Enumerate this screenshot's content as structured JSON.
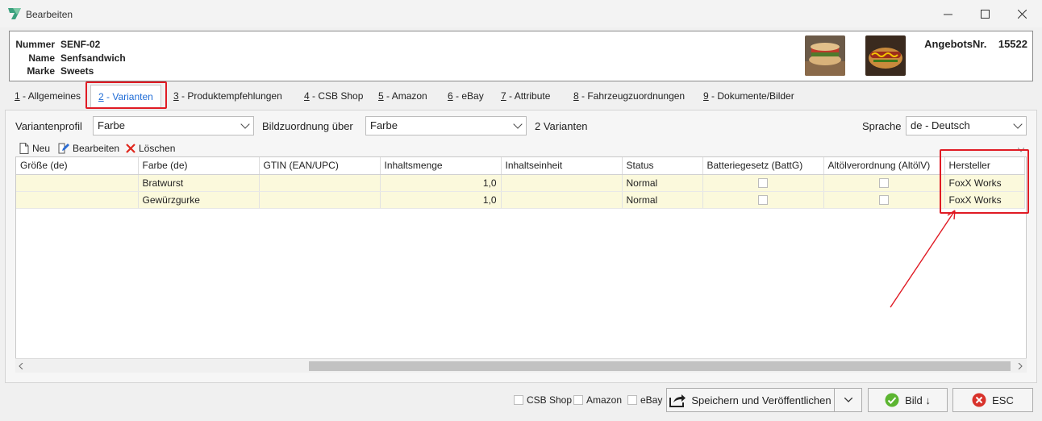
{
  "window": {
    "title": "Bearbeiten"
  },
  "header": {
    "nummer_label": "Nummer",
    "nummer": "SENF-02",
    "name_label": "Name",
    "name": "Senfsandwich",
    "marke_label": "Marke",
    "marke": "Sweets",
    "angebot_label": "AngebotsNr.",
    "angebot": "15522"
  },
  "tabs": [
    {
      "key": "1",
      "label": " - Allgemeines"
    },
    {
      "key": "2",
      "label": " - Varianten"
    },
    {
      "key": "3",
      "label": " - Produktempfehlungen"
    },
    {
      "key": "4",
      "label": " - CSB Shop"
    },
    {
      "key": "5",
      "label": " - Amazon"
    },
    {
      "key": "6",
      "label": " - eBay"
    },
    {
      "key": "7",
      "label": " - Attribute"
    },
    {
      "key": "8",
      "label": " - Fahrzeugzuordnungen"
    },
    {
      "key": "9",
      "label": " - Dokumente/Bilder"
    }
  ],
  "filters": {
    "profil_label": "Variantenprofil",
    "profil": "Farbe",
    "bild_label": "Bildzuordnung über",
    "bild": "Farbe",
    "count": "2 Varianten",
    "sprache_label": "Sprache",
    "sprache": "de - Deutsch"
  },
  "toolbar": {
    "new": "Neu",
    "edit": "Bearbeiten",
    "delete": "Löschen"
  },
  "table": {
    "columns": [
      "Größe (de)",
      "Farbe (de)",
      "GTIN (EAN/UPC)",
      "Inhaltsmenge",
      "Inhaltseinheit",
      "Status",
      "Batteriegesetz (BattG)",
      "Altölverordnung (AltölV)",
      "Hersteller"
    ],
    "rows": [
      [
        "",
        "Bratwurst",
        "",
        "1,0",
        "",
        "Normal",
        "",
        "",
        "FoxX Works"
      ],
      [
        "",
        "Gewürzgurke",
        "",
        "1,0",
        "",
        "Normal",
        "",
        "",
        "FoxX Works"
      ]
    ]
  },
  "footer": {
    "csb": "CSB Shop",
    "amazon": "Amazon",
    "ebay": "eBay",
    "publish": "Speichern und Veröffentlichen",
    "bild": "Bild ↓",
    "esc": "ESC"
  },
  "colors": {
    "accent": "#1e6bd6",
    "highlight": "#e01b24",
    "row_bg": "#fbf9dc"
  },
  "icons": [
    "app-icon",
    "new-doc-icon",
    "edit-icon",
    "delete-icon",
    "share-icon",
    "check-icon",
    "close-icon",
    "minimize-icon",
    "maximize-icon"
  ]
}
